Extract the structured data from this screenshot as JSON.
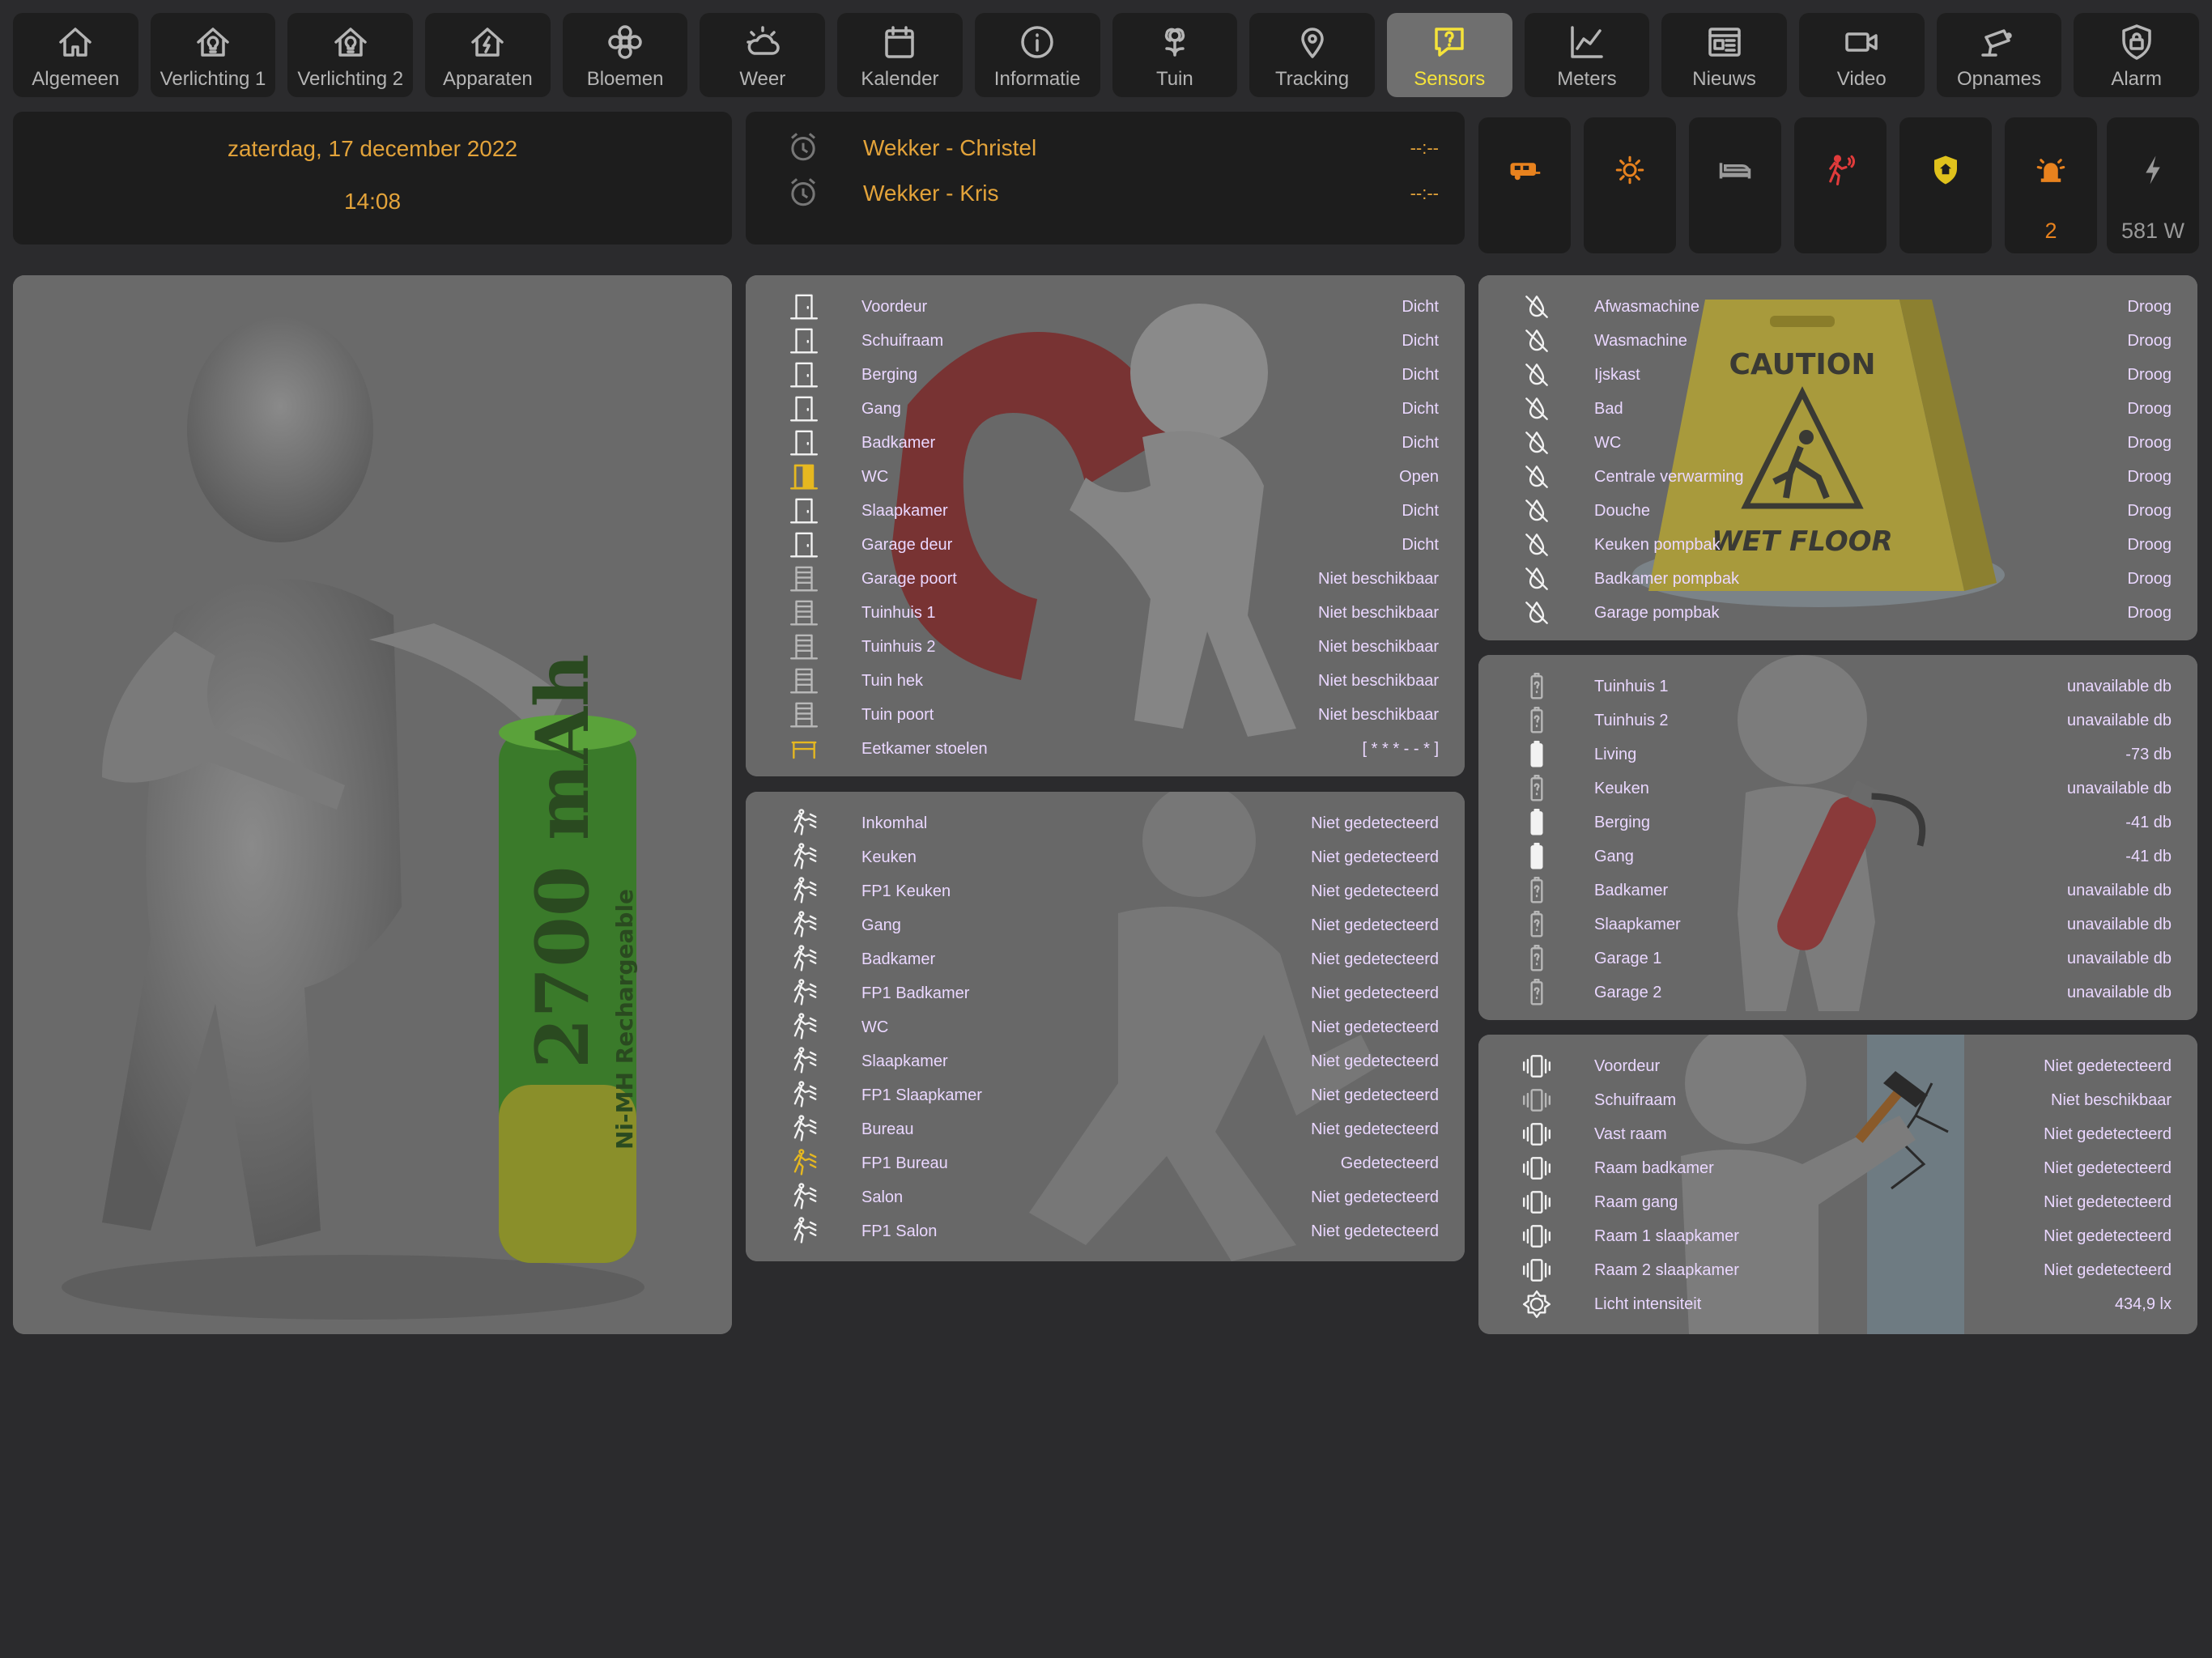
{
  "nav": [
    {
      "label": "Algemeen",
      "icon": "home-icon"
    },
    {
      "label": "Verlichting 1",
      "icon": "home-light-icon"
    },
    {
      "label": "Verlichting 2",
      "icon": "home-light-icon"
    },
    {
      "label": "Apparaten",
      "icon": "home-flash-icon"
    },
    {
      "label": "Bloemen",
      "icon": "flower-icon"
    },
    {
      "label": "Weer",
      "icon": "weather-icon"
    },
    {
      "label": "Kalender",
      "icon": "calendar-icon"
    },
    {
      "label": "Informatie",
      "icon": "info-icon"
    },
    {
      "label": "Tuin",
      "icon": "garden-icon"
    },
    {
      "label": "Tracking",
      "icon": "map-pin-icon"
    },
    {
      "label": "Sensors",
      "icon": "question-bubble-icon",
      "active": true
    },
    {
      "label": "Meters",
      "icon": "chart-icon"
    },
    {
      "label": "Nieuws",
      "icon": "news-icon"
    },
    {
      "label": "Video",
      "icon": "video-icon"
    },
    {
      "label": "Opnames",
      "icon": "camera-icon"
    },
    {
      "label": "Alarm",
      "icon": "lock-icon"
    }
  ],
  "datetime": {
    "date": "zaterdag, 17 december 2022",
    "time": "14:08"
  },
  "alarms": [
    {
      "label": "Wekker - Christel",
      "value": "--:--"
    },
    {
      "label": "Wekker - Kris",
      "value": "--:--"
    }
  ],
  "status_tiles": [
    {
      "icon": "caravan-icon",
      "value": "",
      "color": "#e8821e"
    },
    {
      "icon": "sun-icon",
      "value": "",
      "color": "#e8821e"
    },
    {
      "icon": "bed-icon",
      "value": "",
      "color": "#9a9a9a"
    },
    {
      "icon": "motion-person-icon",
      "value": "",
      "color": "#e03b3b"
    },
    {
      "icon": "shield-home-icon",
      "value": "",
      "color": "#e0c21c"
    },
    {
      "icon": "alarm-light-icon",
      "value": "2",
      "color": "#e8821e"
    },
    {
      "icon": "flash-icon",
      "value": "581 W",
      "color": "#9a9a9a"
    }
  ],
  "doors": [
    {
      "label": "Voordeur",
      "value": "Dicht",
      "state": "closed"
    },
    {
      "label": "Schuifraam",
      "value": "Dicht",
      "state": "closed"
    },
    {
      "label": "Berging",
      "value": "Dicht",
      "state": "closed"
    },
    {
      "label": "Gang",
      "value": "Dicht",
      "state": "closed"
    },
    {
      "label": "Badkamer",
      "value": "Dicht",
      "state": "closed"
    },
    {
      "label": "WC",
      "value": "Open",
      "state": "open"
    },
    {
      "label": "Slaapkamer",
      "value": "Dicht",
      "state": "closed"
    },
    {
      "label": "Garage deur",
      "value": "Dicht",
      "state": "closed"
    },
    {
      "label": "Garage poort",
      "value": "Niet beschikbaar",
      "state": "na"
    },
    {
      "label": "Tuinhuis 1",
      "value": "Niet beschikbaar",
      "state": "na"
    },
    {
      "label": "Tuinhuis 2",
      "value": "Niet beschikbaar",
      "state": "na"
    },
    {
      "label": "Tuin hek",
      "value": "Niet beschikbaar",
      "state": "na"
    },
    {
      "label": "Tuin poort",
      "value": "Niet beschikbaar",
      "state": "na"
    },
    {
      "label": "Eetkamer stoelen",
      "value": "[ * * * - - * ]",
      "state": "chair"
    }
  ],
  "motion": [
    {
      "label": "Inkomhal",
      "value": "Niet gedetecteerd"
    },
    {
      "label": "Keuken",
      "value": "Niet gedetecteerd"
    },
    {
      "label": "FP1 Keuken",
      "value": "Niet gedetecteerd"
    },
    {
      "label": "Gang",
      "value": "Niet gedetecteerd"
    },
    {
      "label": "Badkamer",
      "value": "Niet gedetecteerd"
    },
    {
      "label": "FP1 Badkamer",
      "value": "Niet gedetecteerd"
    },
    {
      "label": "WC",
      "value": "Niet gedetecteerd"
    },
    {
      "label": "Slaapkamer",
      "value": "Niet gedetecteerd"
    },
    {
      "label": "FP1 Slaapkamer",
      "value": "Niet gedetecteerd"
    },
    {
      "label": "Bureau",
      "value": "Niet gedetecteerd"
    },
    {
      "label": "FP1 Bureau",
      "value": "Gedetecteerd",
      "active": true
    },
    {
      "label": "Salon",
      "value": "Niet gedetecteerd"
    },
    {
      "label": "FP1 Salon",
      "value": "Niet gedetecteerd"
    }
  ],
  "leaks": [
    {
      "label": "Afwasmachine",
      "value": "Droog"
    },
    {
      "label": "Wasmachine",
      "value": "Droog"
    },
    {
      "label": "Ijskast",
      "value": "Droog"
    },
    {
      "label": "Bad",
      "value": "Droog"
    },
    {
      "label": "WC",
      "value": "Droog"
    },
    {
      "label": "Centrale verwarming",
      "value": "Droog"
    },
    {
      "label": "Douche",
      "value": "Droog"
    },
    {
      "label": "Keuken pompbak",
      "value": "Droog"
    },
    {
      "label": "Badkamer pompbak",
      "value": "Droog"
    },
    {
      "label": "Garage pompbak",
      "value": "Droog"
    }
  ],
  "leak_sign": {
    "caution": "CAUTION",
    "wet_floor": "WET FLOOR"
  },
  "smoke": [
    {
      "label": "Tuinhuis 1",
      "value": "unavailable db",
      "state": "unknown"
    },
    {
      "label": "Tuinhuis 2",
      "value": "unavailable db",
      "state": "unknown"
    },
    {
      "label": "Living",
      "value": "-73 db",
      "state": "ok"
    },
    {
      "label": "Keuken",
      "value": "unavailable db",
      "state": "unknown"
    },
    {
      "label": "Berging",
      "value": "-41 db",
      "state": "ok"
    },
    {
      "label": "Gang",
      "value": "-41 db",
      "state": "ok"
    },
    {
      "label": "Badkamer",
      "value": "unavailable db",
      "state": "unknown"
    },
    {
      "label": "Slaapkamer",
      "value": "unavailable db",
      "state": "unknown"
    },
    {
      "label": "Garage 1",
      "value": "unavailable db",
      "state": "unknown"
    },
    {
      "label": "Garage 2",
      "value": "unavailable db",
      "state": "unknown"
    }
  ],
  "vibration": [
    {
      "label": "Voordeur",
      "value": "Niet gedetecteerd",
      "icon": "vibrate-icon"
    },
    {
      "label": "Schuifraam",
      "value": "Niet beschikbaar",
      "icon": "vibrate-icon",
      "dim": true
    },
    {
      "label": "Vast raam",
      "value": "Niet gedetecteerd",
      "icon": "vibrate-icon"
    },
    {
      "label": "Raam badkamer",
      "value": "Niet gedetecteerd",
      "icon": "vibrate-icon"
    },
    {
      "label": "Raam gang",
      "value": "Niet gedetecteerd",
      "icon": "vibrate-icon"
    },
    {
      "label": "Raam 1 slaapkamer",
      "value": "Niet gedetecteerd",
      "icon": "vibrate-icon"
    },
    {
      "label": "Raam 2 slaapkamer",
      "value": "Niet gedetecteerd",
      "icon": "vibrate-icon"
    },
    {
      "label": "Licht intensiteit",
      "value": "434,9 lx",
      "icon": "brightness-icon"
    }
  ],
  "battery_image": {
    "label": "2700 mAh",
    "sub": "Ni-MH Rechargeable"
  }
}
